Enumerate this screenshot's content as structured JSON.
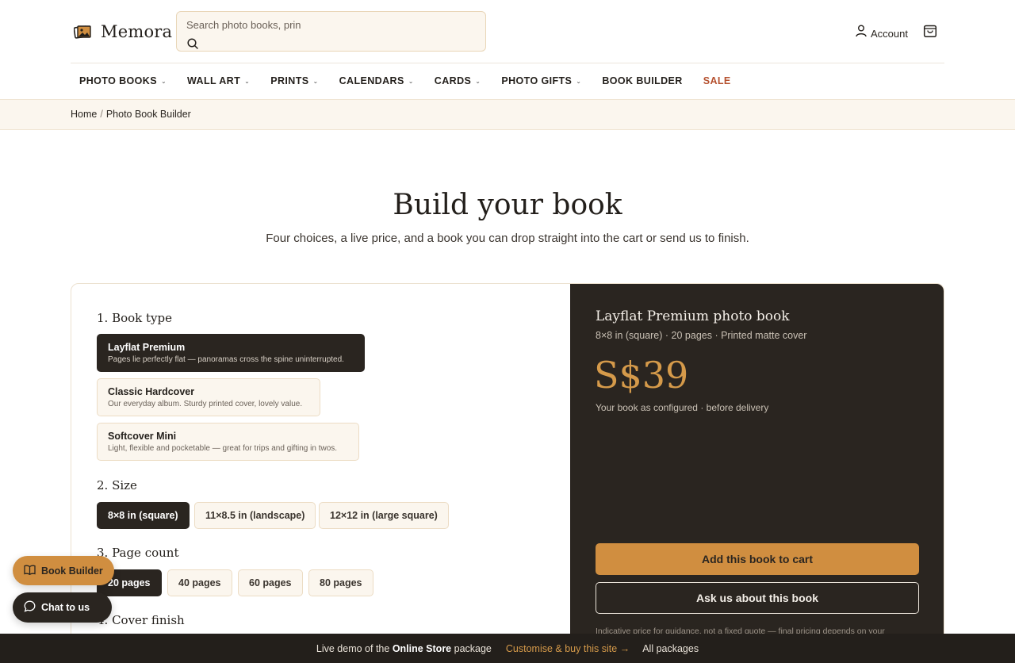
{
  "brand": {
    "name": "Memora"
  },
  "search": {
    "placeholder": "Search photo books, prin"
  },
  "header": {
    "account_label": "Account"
  },
  "nav": {
    "items": [
      {
        "label": "PHOTO BOOKS",
        "has_dropdown": true
      },
      {
        "label": "WALL ART",
        "has_dropdown": true
      },
      {
        "label": "PRINTS",
        "has_dropdown": true
      },
      {
        "label": "CALENDARS",
        "has_dropdown": true
      },
      {
        "label": "CARDS",
        "has_dropdown": true
      },
      {
        "label": "PHOTO GIFTS",
        "has_dropdown": true
      },
      {
        "label": "BOOK BUILDER",
        "has_dropdown": false
      },
      {
        "label": "SALE",
        "has_dropdown": false
      }
    ]
  },
  "breadcrumb": {
    "home": "Home",
    "separator": "/",
    "current": "Photo Book Builder"
  },
  "hero": {
    "title": "Build your book",
    "subtitle": "Four choices, a live price, and a book you can drop straight into the cart or send us to finish."
  },
  "builder": {
    "book_type": {
      "title": "1. Book type",
      "options": [
        {
          "title": "Layflat Premium",
          "desc": "Pages lie perfectly flat — panoramas cross the spine uninterrupted.",
          "selected": true
        },
        {
          "title": "Classic Hardcover",
          "desc": "Our everyday album. Sturdy printed cover, lovely value.",
          "selected": false
        },
        {
          "title": "Softcover Mini",
          "desc": "Light, flexible and pocketable — great for trips and gifting in twos.",
          "selected": false
        }
      ]
    },
    "size": {
      "title": "2. Size",
      "options": [
        {
          "label": "8×8 in (square)",
          "selected": true
        },
        {
          "label": "11×8.5 in (landscape)",
          "selected": false
        },
        {
          "label": "12×12 in (large square)",
          "selected": false
        }
      ]
    },
    "page_count": {
      "title": "3. Page count",
      "options": [
        {
          "label": "20 pages",
          "selected": true
        },
        {
          "label": "40 pages",
          "selected": false
        },
        {
          "label": "60 pages",
          "selected": false
        },
        {
          "label": "80 pages",
          "selected": false
        }
      ]
    },
    "cover_finish": {
      "title": "4. Cover finish"
    }
  },
  "summary": {
    "title": "Layflat Premium photo book",
    "subtitle": "8×8 in (square) · 20 pages · Printed matte cover",
    "price": "S$39",
    "price_note": "Your book as configured · before delivery",
    "add_to_cart": "Add this book to cart",
    "ask": "Ask us about this book",
    "fine_print": "Indicative price for guidance, not a fixed quote — final pricing depends on your"
  },
  "floating": {
    "book_builder": "Book Builder",
    "chat": "Chat to us"
  },
  "bottom_bar": {
    "prefix": "Live demo of the",
    "package": "Online Store",
    "suffix": "package",
    "cta": "Customise & buy this site →",
    "all": "All packages"
  },
  "colors": {
    "accent": "#d08e40",
    "dark": "#2a2520",
    "sale": "#b5502e",
    "cream": "#fbf6ee"
  }
}
